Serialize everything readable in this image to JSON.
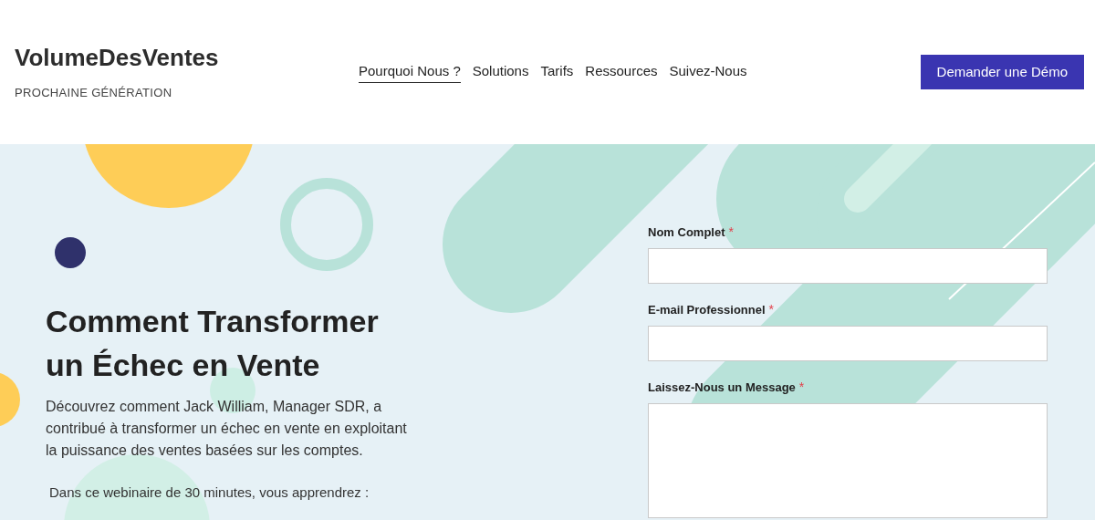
{
  "header": {
    "logo": "VolumeDesVentes",
    "tagline": "PROCHAINE GÉNÉRATION",
    "nav": [
      {
        "label": "Pourquoi Nous ?",
        "selected": true
      },
      {
        "label": "Solutions",
        "selected": false
      },
      {
        "label": "Tarifs",
        "selected": false
      },
      {
        "label": "Ressources",
        "selected": false
      },
      {
        "label": "Suivez-Nous",
        "selected": false
      }
    ],
    "cta": "Demander une Démo"
  },
  "hero": {
    "heading": "Comment Transformer un Échec en Vente",
    "description": "Découvrez comment Jack William, Manager SDR, a contribué à transformer un échec en vente en exploitant la puissance des ventes basées sur les comptes.",
    "intro": "Dans ce webinaire de 30 minutes, vous apprendrez :"
  },
  "form": {
    "fields": [
      {
        "label": "Nom Complet",
        "required_mark": "*",
        "kind": "input"
      },
      {
        "label": "E-mail Professionnel",
        "required_mark": "*",
        "kind": "input"
      },
      {
        "label": "Laissez-Nous un Message",
        "required_mark": "*",
        "kind": "textarea"
      }
    ]
  }
}
